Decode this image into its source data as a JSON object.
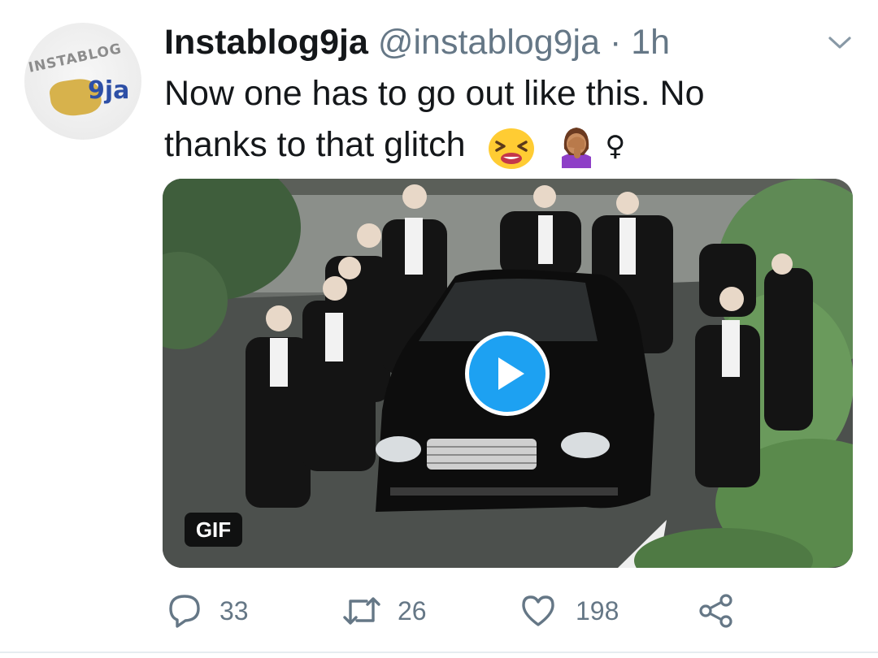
{
  "tweet": {
    "display_name": "Instablog9ja",
    "handle": "@instablog9ja",
    "separator": "·",
    "time": "1h",
    "text_line1": "Now one has to go out like this. No",
    "text_line2": "thanks to that glitch",
    "emoji_1": "tired-face-emoji",
    "emoji_2": "woman-facepalming-emoji",
    "emoji_3": "♀"
  },
  "avatar": {
    "logo_text_top": "INSTABLOG",
    "logo_text_bottom": "9ja"
  },
  "media": {
    "badge": "GIF",
    "play_icon": "play-icon"
  },
  "actions": {
    "replies": "33",
    "retweets": "26",
    "likes": "198"
  },
  "colors": {
    "accent": "#1da1f2",
    "text": "#14171a",
    "muted": "#657786"
  }
}
